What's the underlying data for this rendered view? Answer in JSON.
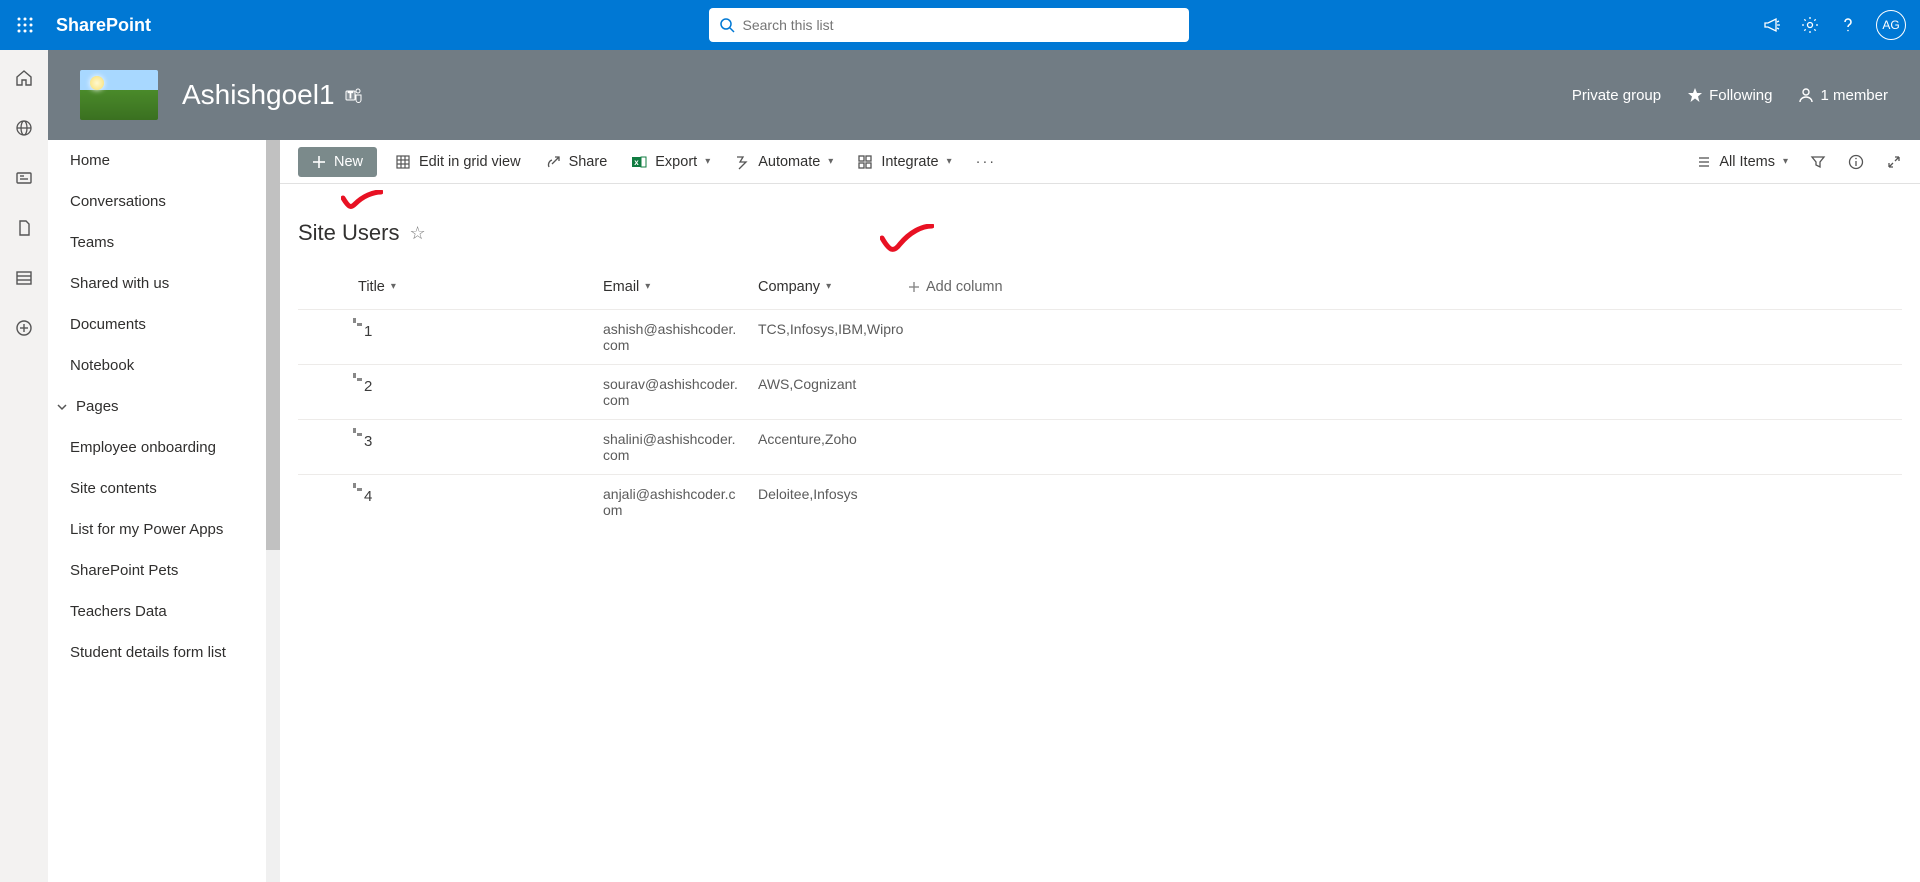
{
  "topbar": {
    "brand": "SharePoint",
    "search_placeholder": "Search this list",
    "avatar_initials": "AG"
  },
  "site": {
    "title": "Ashishgoel1",
    "privacy": "Private group",
    "following_label": "Following",
    "members_label": "1 member"
  },
  "leftnav": {
    "items": [
      {
        "label": "Home"
      },
      {
        "label": "Conversations"
      },
      {
        "label": "Teams"
      },
      {
        "label": "Shared with us"
      },
      {
        "label": "Documents"
      },
      {
        "label": "Notebook"
      },
      {
        "label": "Pages",
        "group": true
      },
      {
        "label": "Employee onboarding"
      },
      {
        "label": "Site contents"
      },
      {
        "label": "List for my Power Apps"
      },
      {
        "label": "SharePoint Pets"
      },
      {
        "label": "Teachers Data"
      },
      {
        "label": "Student details form list"
      }
    ]
  },
  "cmd": {
    "new": "New",
    "edit_grid": "Edit in grid view",
    "share": "Share",
    "export": "Export",
    "automate": "Automate",
    "integrate": "Integrate",
    "view": "All Items"
  },
  "list": {
    "title": "Site Users",
    "columns": {
      "title": "Title",
      "email": "Email",
      "company": "Company",
      "add": "Add column"
    },
    "rows": [
      {
        "title": "1",
        "email": "ashish@ashishcoder.com",
        "company": "TCS,Infosys,IBM,Wipro"
      },
      {
        "title": "2",
        "email": "sourav@ashishcoder.com",
        "company": "AWS,Cognizant"
      },
      {
        "title": "3",
        "email": "shalini@ashishcoder.com",
        "company": "Accenture,Zoho"
      },
      {
        "title": "4",
        "email": "anjali@ashishcoder.com",
        "company": "Deloitee,Infosys"
      }
    ]
  }
}
